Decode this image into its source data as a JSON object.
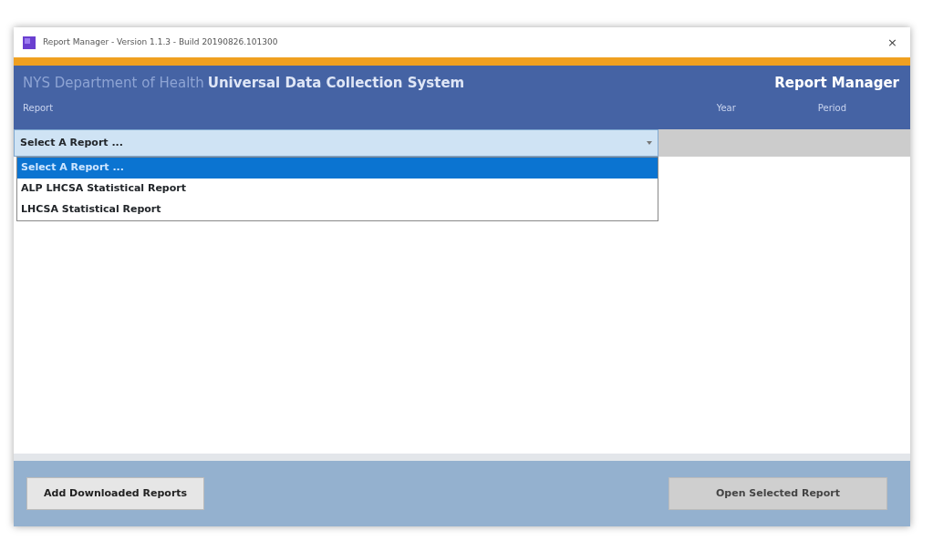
{
  "window": {
    "title": "Report Manager - Version 1.1.3 - Build 20190826.101300",
    "close": "×"
  },
  "header": {
    "organization": "NYS Department of Health",
    "system": "Universal Data Collection System",
    "app_name": "Report Manager"
  },
  "filters": {
    "report_label": "Report",
    "year_label": "Year",
    "period_label": "Period",
    "report": {
      "value": "Select A Report ...",
      "expanded": true,
      "options": [
        {
          "label": "Select A Report ...",
          "selected": true
        },
        {
          "label": "ALP LHCSA Statistical Report",
          "selected": false
        },
        {
          "label": "LHCSA Statistical Report",
          "selected": false
        }
      ]
    },
    "year": {
      "disabled": true
    },
    "period": {
      "disabled": true
    }
  },
  "buttons": [
    {
      "label": "Add Downloaded Reports",
      "disabled": false
    },
    {
      "label": "Open Selected Report",
      "disabled": true
    }
  ]
}
